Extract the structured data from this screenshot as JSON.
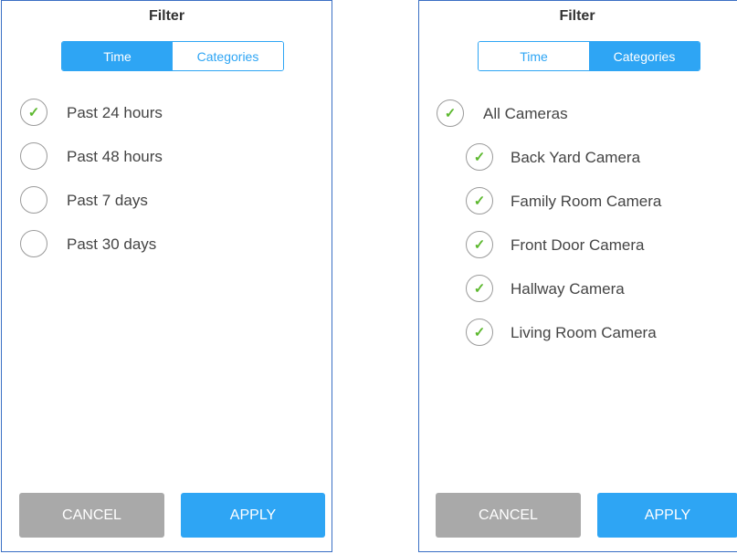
{
  "colors": {
    "accent": "#2ea5f4",
    "check": "#5cb82e",
    "cancel_bg": "#a9a9a9",
    "border": "#3a6fc4"
  },
  "left_panel": {
    "title": "Filter",
    "tabs": [
      {
        "label": "Time",
        "active": true
      },
      {
        "label": "Categories",
        "active": false
      }
    ],
    "options": [
      {
        "label": "Past 24 hours",
        "checked": true
      },
      {
        "label": "Past 48 hours",
        "checked": false
      },
      {
        "label": "Past 7 days",
        "checked": false
      },
      {
        "label": "Past 30 days",
        "checked": false
      }
    ],
    "cancel_label": "CANCEL",
    "apply_label": "APPLY"
  },
  "right_panel": {
    "title": "Filter",
    "tabs": [
      {
        "label": "Time",
        "active": false
      },
      {
        "label": "Categories",
        "active": true
      }
    ],
    "all_option": {
      "label": "All Cameras",
      "checked": true
    },
    "cameras": [
      {
        "label": "Back Yard Camera",
        "checked": true
      },
      {
        "label": "Family Room Camera",
        "checked": true
      },
      {
        "label": "Front Door Camera",
        "checked": true
      },
      {
        "label": "Hallway Camera",
        "checked": true
      },
      {
        "label": "Living Room Camera",
        "checked": true
      }
    ],
    "cancel_label": "CANCEL",
    "apply_label": "APPLY"
  },
  "icons": {
    "check": "✓"
  }
}
